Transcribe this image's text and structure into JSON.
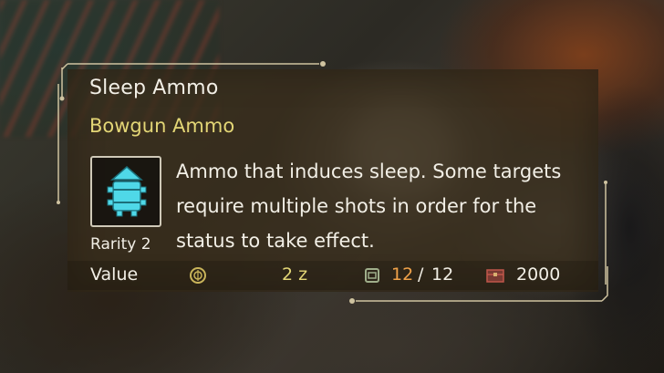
{
  "item": {
    "name": "Sleep Ammo",
    "type": "Bowgun Ammo",
    "rarity": "Rarity 2",
    "description": "Ammo that induces sleep. Some targets require multiple shots in order for the status to take effect.",
    "icon": "sleep-ammo-icon"
  },
  "stats": {
    "value_label": "Value",
    "value_icon": "zenny-coin-icon",
    "value_amount": "2 z",
    "carry_icon": "item-pouch-icon",
    "carry_current": "12",
    "carry_separator": "/",
    "carry_max": "12",
    "box_icon": "item-box-icon",
    "box_amount": "2000"
  },
  "colors": {
    "title": "#f2efe6",
    "type_label": "#e3d676",
    "current_count": "#f0a24a",
    "icon_fill": "#4fd8e8",
    "frame": "#cfc3a0"
  }
}
